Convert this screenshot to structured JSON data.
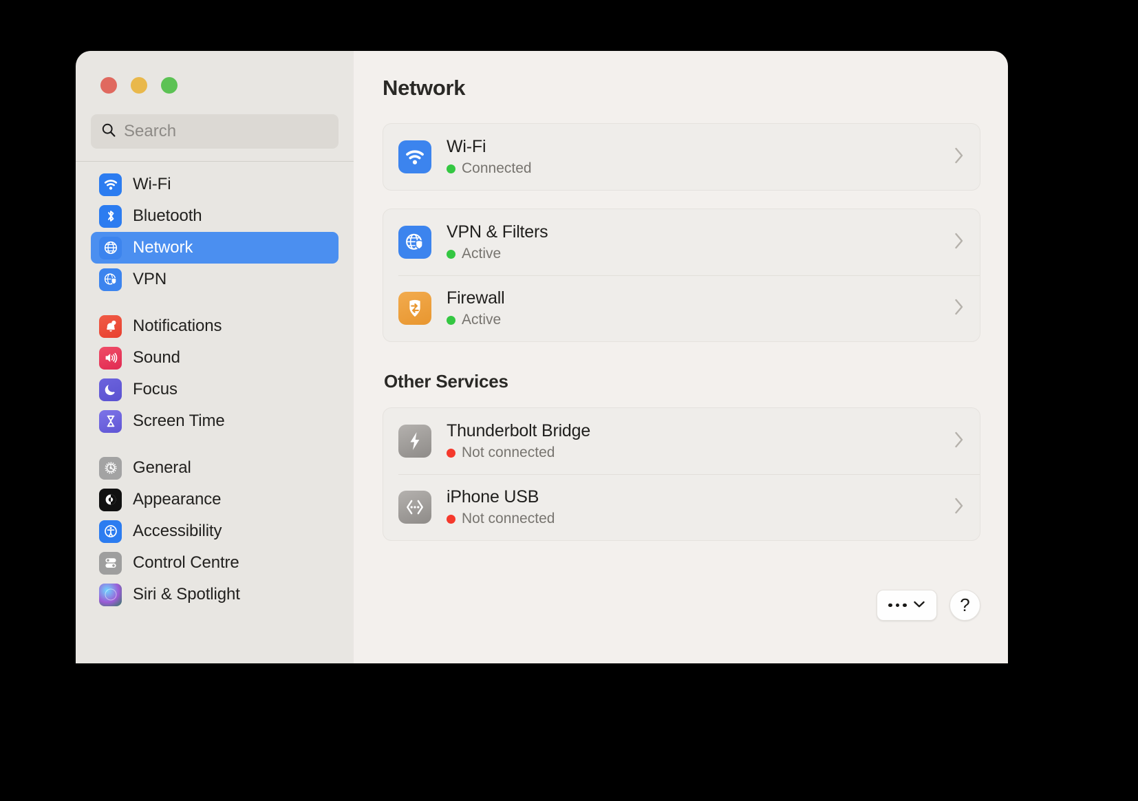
{
  "window": {
    "traffic_lights": [
      {
        "name": "close",
        "color": "#e0695f"
      },
      {
        "name": "minimize",
        "color": "#e9b84b"
      },
      {
        "name": "maximize",
        "color": "#5cc254"
      }
    ]
  },
  "search": {
    "placeholder": "Search",
    "value": "",
    "icon": "search-icon"
  },
  "sidebar": {
    "groups": [
      {
        "items": [
          {
            "label": "Wi-Fi",
            "icon": "wifi-icon",
            "selected": false
          },
          {
            "label": "Bluetooth",
            "icon": "bluetooth-icon",
            "selected": false
          },
          {
            "label": "Network",
            "icon": "globe-icon",
            "selected": true
          },
          {
            "label": "VPN",
            "icon": "vpn-icon",
            "selected": false
          }
        ]
      },
      {
        "items": [
          {
            "label": "Notifications",
            "icon": "bell-icon",
            "selected": false
          },
          {
            "label": "Sound",
            "icon": "speaker-icon",
            "selected": false
          },
          {
            "label": "Focus",
            "icon": "moon-icon",
            "selected": false
          },
          {
            "label": "Screen Time",
            "icon": "hourglass-icon",
            "selected": false
          }
        ]
      },
      {
        "items": [
          {
            "label": "General",
            "icon": "gear-icon",
            "selected": false
          },
          {
            "label": "Appearance",
            "icon": "appearance-icon",
            "selected": false
          },
          {
            "label": "Accessibility",
            "icon": "accessibility-icon",
            "selected": false
          },
          {
            "label": "Control Centre",
            "icon": "control-centre-icon",
            "selected": false
          },
          {
            "label": "Siri & Spotlight",
            "icon": "siri-icon",
            "selected": false
          }
        ]
      }
    ]
  },
  "main": {
    "title": "Network",
    "section_title": "Other Services",
    "primary_services": [
      {
        "title": "Wi-Fi",
        "status": "Connected",
        "status_color": "green",
        "icon": "wifi-icon"
      },
      {
        "title": "VPN & Filters",
        "status": "Active",
        "status_color": "green",
        "icon": "vpn-filters-icon"
      },
      {
        "title": "Firewall",
        "status": "Active",
        "status_color": "green",
        "icon": "firewall-icon"
      }
    ],
    "other_services": [
      {
        "title": "Thunderbolt Bridge",
        "status": "Not connected",
        "status_color": "red",
        "icon": "thunderbolt-icon"
      },
      {
        "title": "iPhone USB",
        "status": "Not connected",
        "status_color": "red",
        "icon": "iphone-usb-icon"
      }
    ],
    "chevron_icon": "chevron-right-icon",
    "footer": {
      "more_label": "",
      "more_icon": "ellipsis-chevron-down-icon",
      "help_label": "?",
      "help_icon": "question-mark-icon"
    }
  },
  "colors": {
    "accent_selected": "#4b8ff0",
    "status_green": "#34c742",
    "status_red": "#f5392c",
    "sidebar_bg": "#e8e6e2",
    "main_bg": "#f3f0ed"
  }
}
